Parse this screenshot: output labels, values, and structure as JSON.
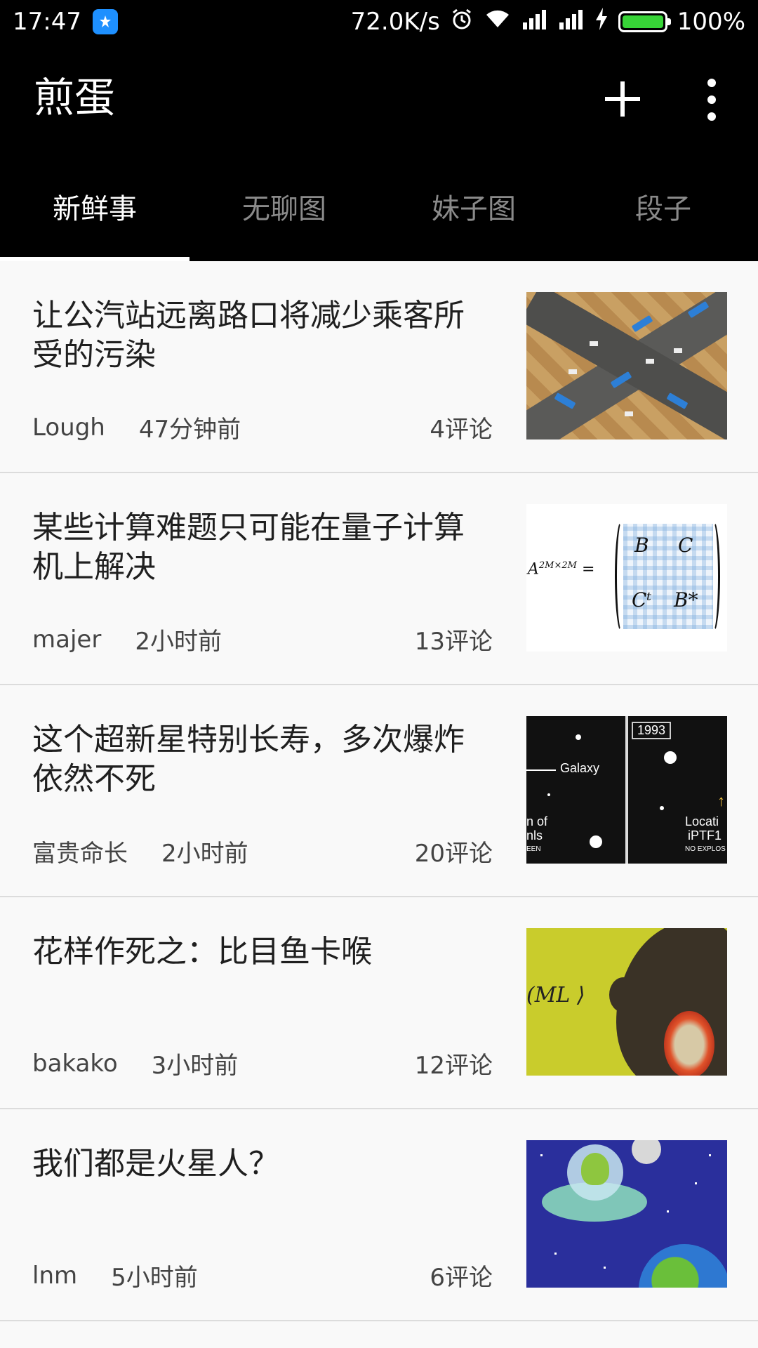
{
  "status_bar": {
    "time": "17:47",
    "net_speed": "72.0K/s",
    "battery": "100%",
    "battery_level": 1.0
  },
  "app_bar": {
    "title": "煎蛋",
    "actions": [
      "add-icon",
      "more-vert-icon"
    ]
  },
  "tabs": [
    {
      "label": "新鲜事",
      "active": true
    },
    {
      "label": "无聊图",
      "active": false
    },
    {
      "label": "妹子图",
      "active": false
    },
    {
      "label": "段子",
      "active": false
    }
  ],
  "feed": [
    {
      "title": "让公汽站远离路口将减少乘客所受的污染",
      "author": "Lough",
      "time": "47分钟前",
      "comments": "4评论"
    },
    {
      "title": "某些计算难题只可能在量子计算机上解决",
      "author": "majer",
      "time": "2小时前",
      "comments": "13评论"
    },
    {
      "title": "这个超新星特别长寿，多次爆炸依然不死",
      "author": "富贵命长",
      "time": "2小时前",
      "comments": "20评论"
    },
    {
      "title": "花样作死之：比目鱼卡喉",
      "author": "bakako",
      "time": "3小时前",
      "comments": "12评论"
    },
    {
      "title": "我们都是火星人？",
      "author": "lnm",
      "time": "5小时前",
      "comments": "6评论"
    }
  ],
  "thumb_text": {
    "matrix_lhs": "A",
    "matrix_lhs_sup": "2M×2M",
    "matrix_eq": "=",
    "matrix_b": "B",
    "matrix_c": "C",
    "matrix_ct": "Cᵗ",
    "matrix_bstar": "B*",
    "stars_galaxy": "Galaxy",
    "stars_year": "1993",
    "stars_left1": "n of",
    "stars_left2": "nls",
    "stars_left3": "EEN",
    "stars_right1": "Locati",
    "stars_right2": "iPTF1",
    "stars_right3": "NO EXPLOS",
    "scrawl": "(ML ⟩"
  },
  "colors": {
    "bar_bg": "#000000",
    "tab_inactive": "#8a8a8a",
    "feed_bg": "#f9f9f9",
    "divider": "#dcdcdc",
    "battery_fill": "#37d437"
  }
}
